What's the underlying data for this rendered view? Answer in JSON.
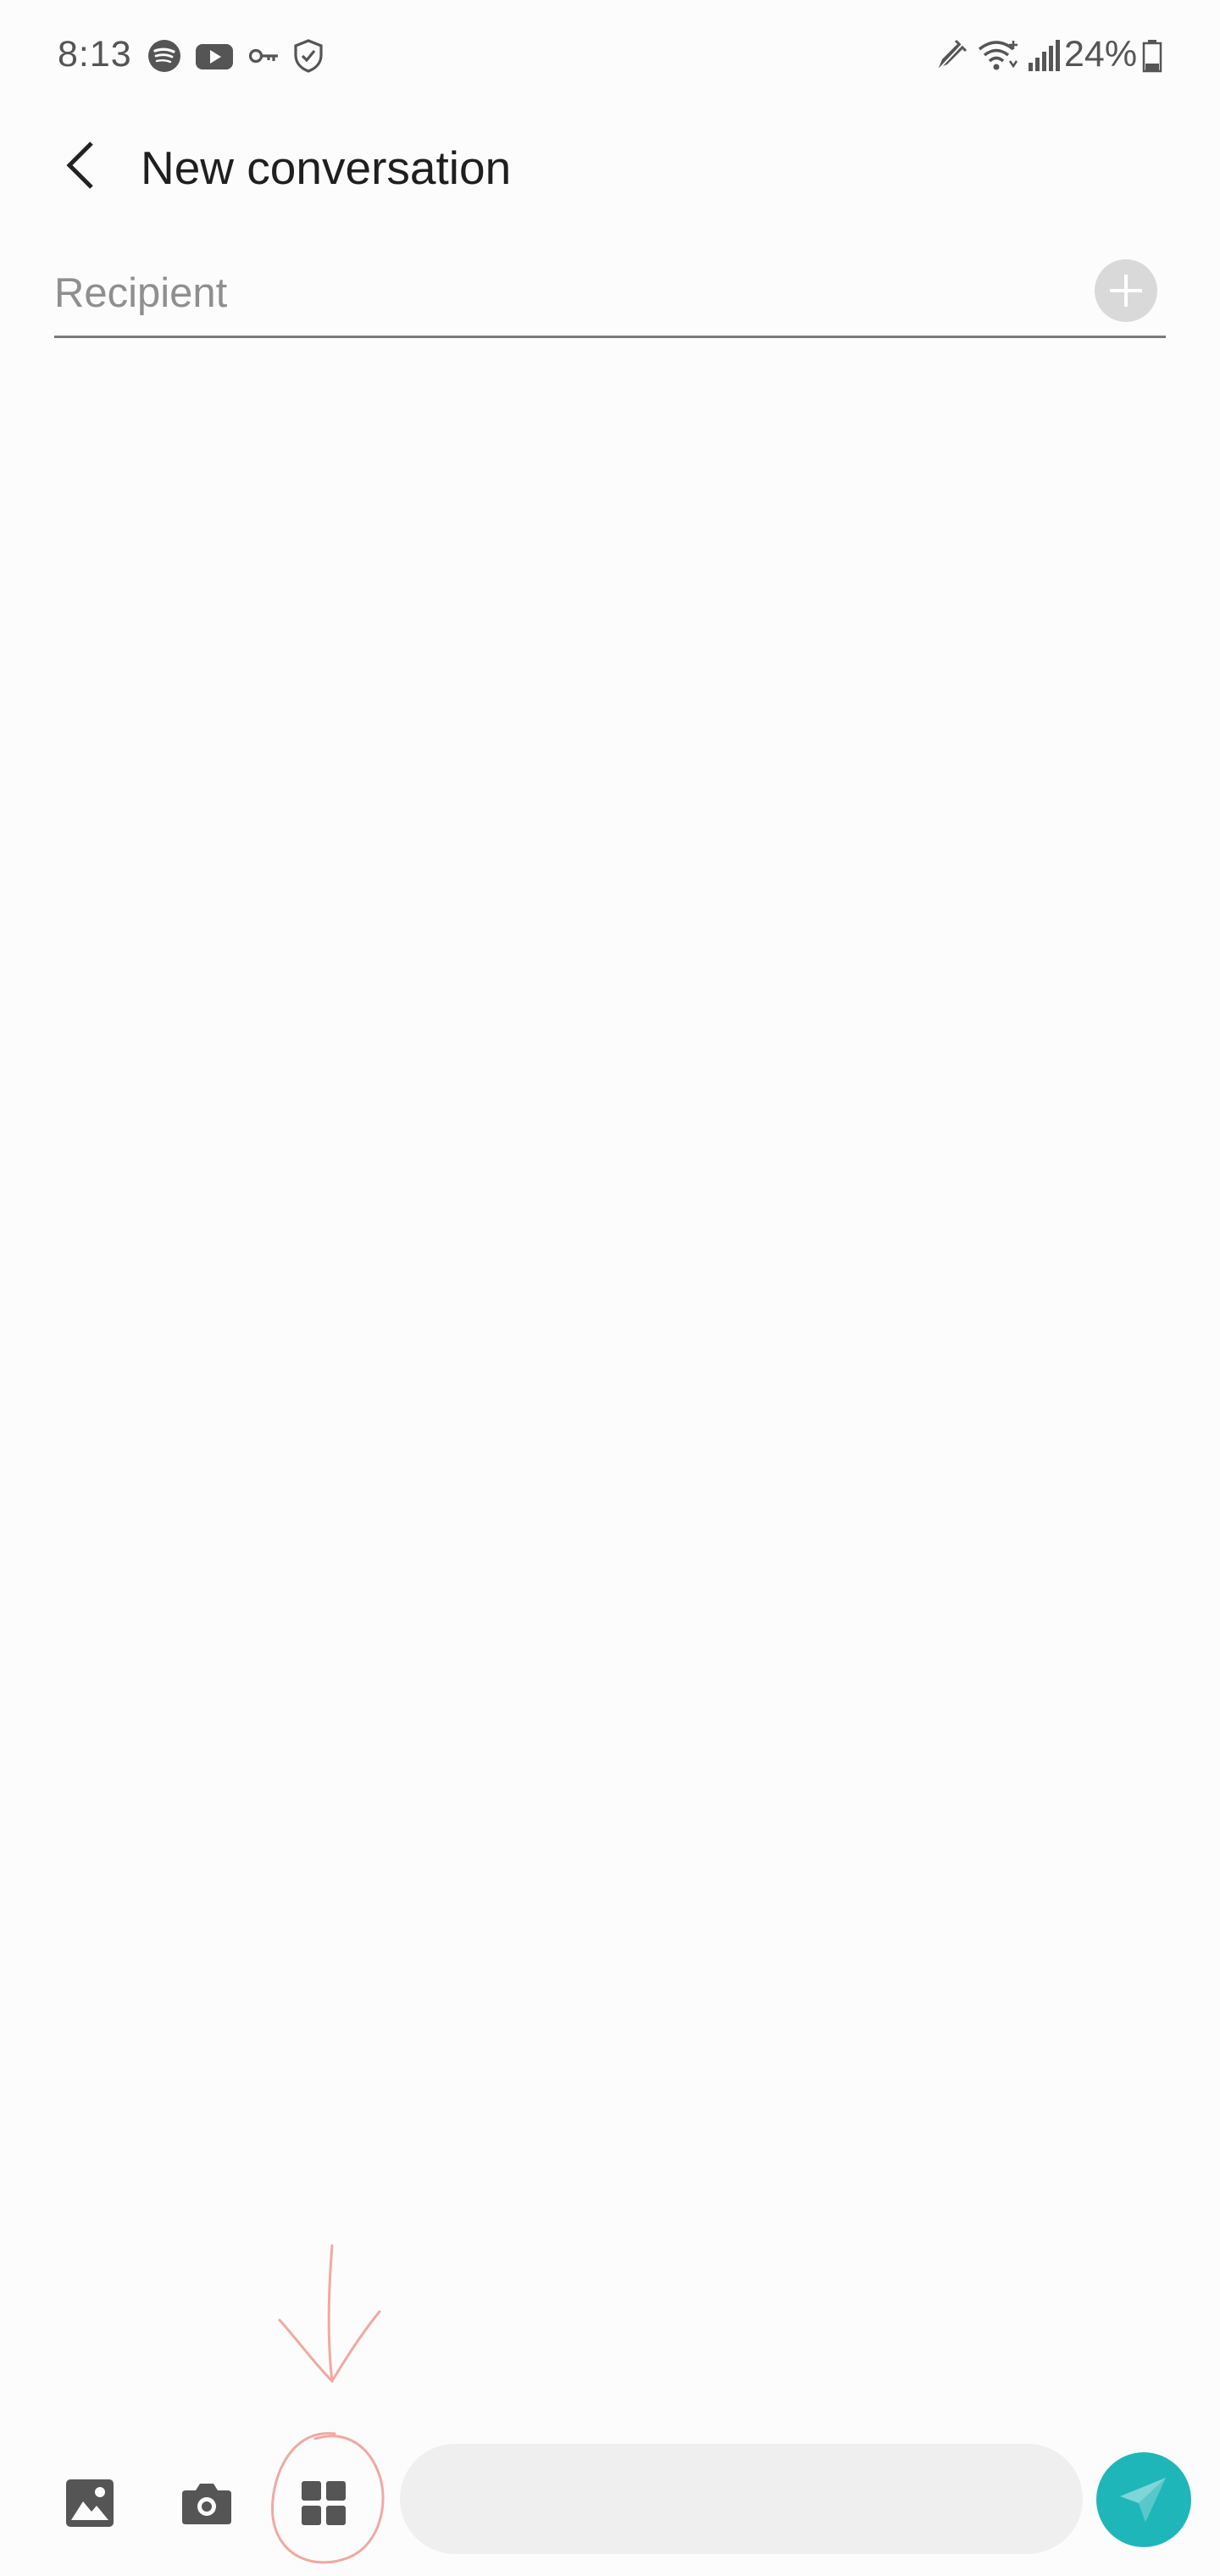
{
  "status_bar": {
    "time": "8:13",
    "battery": "24%",
    "icons_left": [
      "spotify-icon",
      "youtube-icon",
      "vpn-key-icon",
      "shield-check-icon"
    ],
    "icons_right": [
      "pen-icon",
      "wifi-icon",
      "signal-icon",
      "battery-icon"
    ]
  },
  "header": {
    "title": "New conversation",
    "back_icon": "chevron-left-icon"
  },
  "recipient": {
    "placeholder": "Recipient",
    "value": "",
    "add_icon": "plus-icon"
  },
  "composer": {
    "gallery_icon": "gallery-icon",
    "camera_icon": "camera-icon",
    "apps_icon": "apps-grid-icon",
    "message_placeholder": "",
    "send_icon": "send-icon"
  },
  "colors": {
    "background": "#fcfcfc",
    "accent": "#1fb6b9",
    "annotation": "#f0a9a0"
  }
}
